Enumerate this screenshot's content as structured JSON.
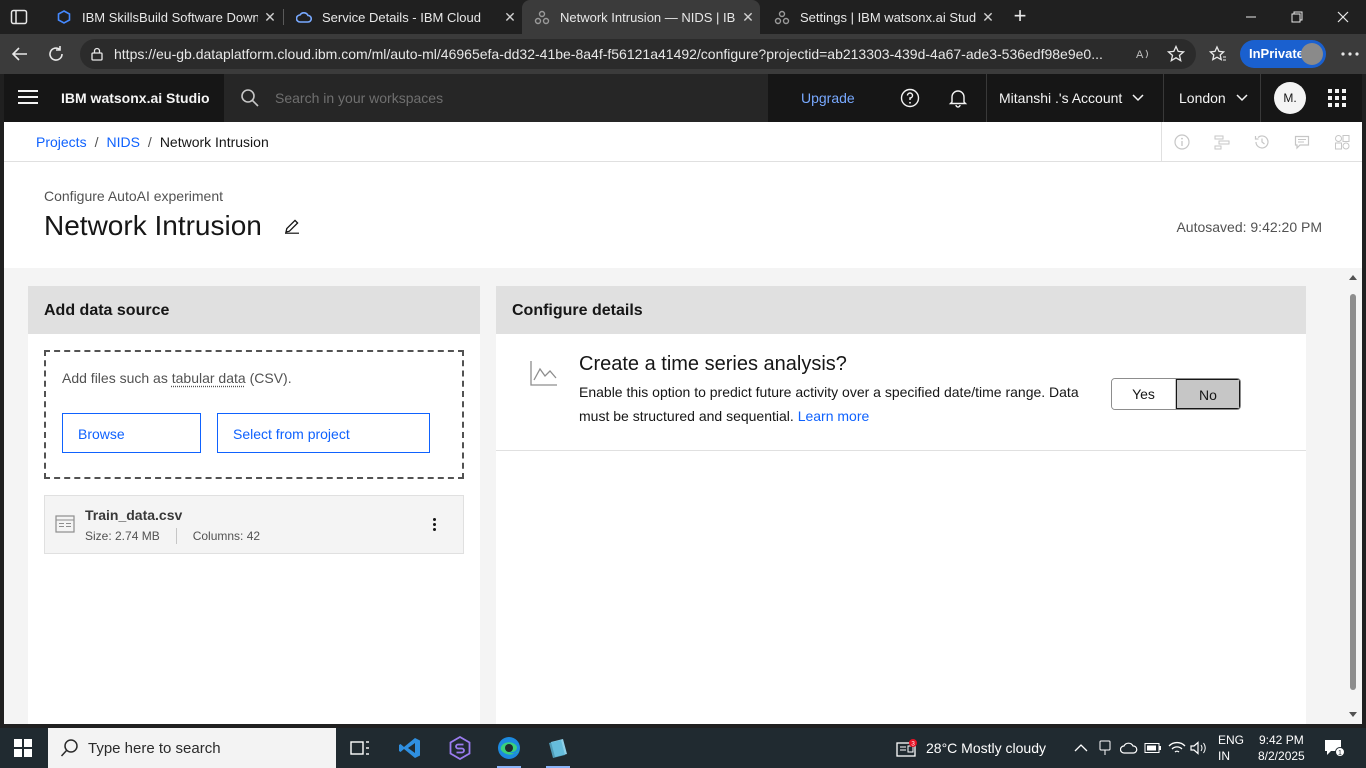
{
  "browser": {
    "tabs": [
      {
        "title": "IBM SkillsBuild Software Downloa",
        "active": false
      },
      {
        "title": "Service Details - IBM Cloud",
        "active": false
      },
      {
        "title": "Network Intrusion — NIDS | IBM w",
        "active": true
      },
      {
        "title": "Settings | IBM watsonx.ai Studio",
        "active": false
      }
    ],
    "url": "https://eu-gb.dataplatform.cloud.ibm.com/ml/auto-ml/46965efa-dd32-41be-8a4f-f56121a41492/configure?projectid=ab213303-439d-4a67-ade3-536edf98e9e0...",
    "inprivate_label": "InPrivate"
  },
  "header": {
    "product_name": "IBM watsonx.ai Studio",
    "search_placeholder": "Search in your workspaces",
    "upgrade": "Upgrade",
    "account": "Mitanshi .'s Account",
    "region": "London",
    "avatar_initials": "M."
  },
  "breadcrumb": {
    "items": [
      "Projects",
      "NIDS"
    ],
    "separator": "/",
    "current": "Network Intrusion"
  },
  "page": {
    "eyebrow": "Configure AutoAI experiment",
    "title": "Network Intrusion",
    "autosaved": "Autosaved: 9:42:20 PM"
  },
  "data_source": {
    "heading": "Add data source",
    "drop_text_prefix": "Add files such as ",
    "drop_text_link": "tabular data",
    "drop_text_suffix": " (CSV).",
    "browse_label": "Browse",
    "select_label": "Select from project",
    "file": {
      "name": "Train_data.csv",
      "size": "Size: 2.74 MB",
      "columns": "Columns: 42"
    }
  },
  "configure": {
    "heading": "Configure details",
    "ts_title": "Create a time series analysis?",
    "ts_desc": "Enable this option to predict future activity over a specified date/time range. Data must be structured and sequential.",
    "learn_more": "Learn more",
    "yes_label": "Yes",
    "no_label": "No",
    "selected": "No"
  },
  "taskbar": {
    "search_placeholder": "Type here to search",
    "weather_badge": "3",
    "weather": "28°C  Mostly cloudy",
    "lang_top": "ENG",
    "lang_bottom": "IN",
    "time": "9:42 PM",
    "date": "8/2/2025",
    "notification_count": "1"
  },
  "colors": {
    "ibm_blue": "#0f62fe",
    "header_bg": "#161616",
    "edge_accent": "#1a60cf"
  }
}
